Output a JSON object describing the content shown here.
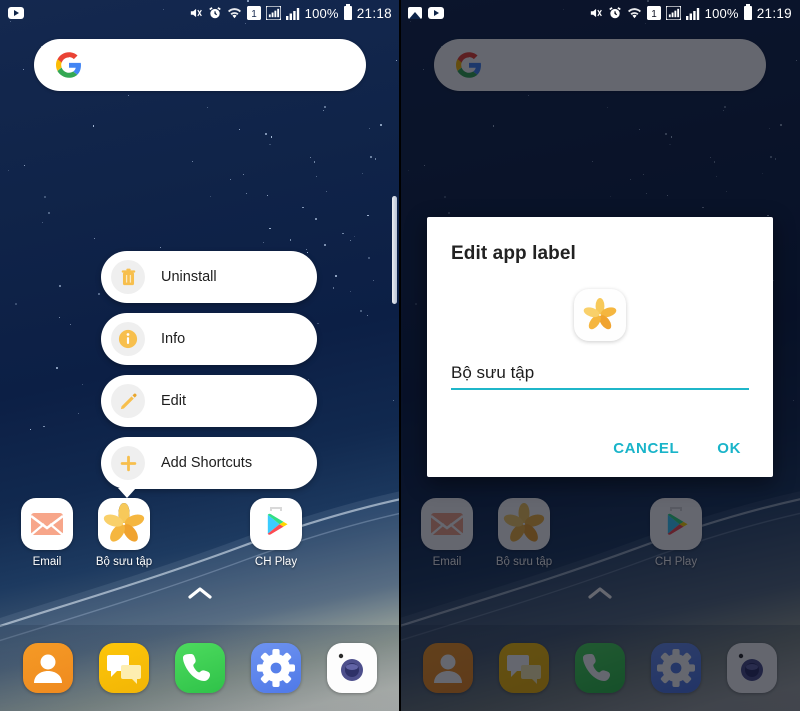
{
  "left": {
    "status_bar": {
      "notifications": [
        "youtube-icon"
      ],
      "icons": [
        "mute-icon",
        "alarm-icon",
        "wifi-icon",
        "sim1-icon",
        "signal-icon",
        "signal2-icon"
      ],
      "battery_percent": "100%",
      "time": "21:18"
    },
    "search": {
      "icon": "google-g-icon",
      "placeholder": ""
    },
    "context_menu": {
      "items": [
        {
          "icon": "trash-icon",
          "label": "Uninstall"
        },
        {
          "icon": "info-icon",
          "label": "Info"
        },
        {
          "icon": "pencil-icon",
          "label": "Edit"
        },
        {
          "icon": "plus-icon",
          "label": "Add Shortcuts"
        }
      ]
    },
    "apps": [
      {
        "name": "Email",
        "icon": "email-icon"
      },
      {
        "name": "Bộ sưu tập",
        "icon": "gallery-flower-icon"
      },
      {
        "name": "CH Play",
        "icon": "play-store-icon"
      }
    ],
    "drawer_indicator": "chevron-up-icon",
    "dock": [
      {
        "name": "Contacts",
        "icon": "contacts-icon"
      },
      {
        "name": "Messages",
        "icon": "messages-icon"
      },
      {
        "name": "Phone",
        "icon": "phone-icon"
      },
      {
        "name": "Settings",
        "icon": "settings-gear-icon"
      },
      {
        "name": "Camera",
        "icon": "camera-icon"
      }
    ],
    "edge_panel_handle": "edge-panel-handle"
  },
  "right": {
    "status_bar": {
      "notifications": [
        "image-icon",
        "youtube-icon"
      ],
      "icons": [
        "mute-icon",
        "alarm-icon",
        "wifi-icon",
        "sim1-icon",
        "signal-icon",
        "signal2-icon"
      ],
      "battery_percent": "100%",
      "time": "21:19"
    },
    "search": {
      "icon": "google-g-icon",
      "placeholder": ""
    },
    "dialog": {
      "title": "Edit app label",
      "app_icon": "gallery-flower-icon",
      "input_value": "Bộ sưu tập",
      "cancel_label": "CANCEL",
      "ok_label": "OK",
      "accent_color": "#19b4c9"
    },
    "apps": [
      {
        "name": "Email",
        "icon": "email-icon"
      },
      {
        "name": "Bộ sưu tập",
        "icon": "gallery-flower-icon"
      },
      {
        "name": "CH Play",
        "icon": "play-store-icon"
      }
    ],
    "drawer_indicator": "chevron-up-icon",
    "dock": [
      {
        "name": "Contacts",
        "icon": "contacts-icon"
      },
      {
        "name": "Messages",
        "icon": "messages-icon"
      },
      {
        "name": "Phone",
        "icon": "phone-icon"
      },
      {
        "name": "Settings",
        "icon": "settings-gear-icon"
      },
      {
        "name": "Camera",
        "icon": "camera-icon"
      }
    ]
  },
  "colors": {
    "wallpaper_top": "#102448",
    "wallpaper_bottom": "#e9e4d2",
    "menu_icon_accent": "#f5b942",
    "dialog_accent": "#19b4c9"
  }
}
